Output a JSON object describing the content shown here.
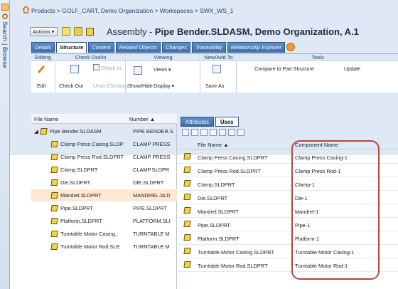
{
  "sidebar": {
    "search": "Search",
    "browse": "Browse"
  },
  "breadcrumb": "Products > GOLF_CART, Demo Organization > Workspaces > SWX_WS_1",
  "actions_label": "Actions ▾",
  "title": {
    "prefix": "Assembly - ",
    "name": "Pipe Bender.SLDASM, Demo Organization, A.1"
  },
  "tabs": [
    "Details",
    "Structure",
    "Content",
    "Related Objects",
    "Changes",
    "Traceability",
    "Relationship Explorer"
  ],
  "ribbon": {
    "editing": {
      "header": "Editing",
      "edit": "Edit"
    },
    "checkout": {
      "header": "Check Out/In",
      "checkin": "Check In",
      "checkout": "Check Out",
      "undo": "Undo Checkout"
    },
    "viewing": {
      "header": "Viewing",
      "views": "Views ▾",
      "showhide": "Show/Hide",
      "display": "Display ▾"
    },
    "newadd": {
      "header": "New/Add To",
      "saveas": "Save As"
    },
    "tools": {
      "header": "Tools",
      "compare": "Compare to Part Structure",
      "update": "Update"
    }
  },
  "tree": {
    "columns": {
      "filename": "File Name",
      "number": "Number ▲"
    },
    "root": {
      "name": "Pipe Bender.SLDASM",
      "number": "PIPE BENDER.S"
    },
    "rows": [
      {
        "name": "Clamp Press Casing.SLDP",
        "number": "CLAMP PRESS"
      },
      {
        "name": "Clamp Press Rod.SLDPRT",
        "number": "CLAMP PRESS"
      },
      {
        "name": "Clamp.SLDPRT",
        "number": "CLAMP.SLDPR"
      },
      {
        "name": "Die.SLDPRT",
        "number": "DIE.SLDPRT"
      },
      {
        "name": "Mandrel.SLDPRT",
        "number": "MANDREL.SLD"
      },
      {
        "name": "Pipe.SLDPRT",
        "number": "PIPE.SLDPRT"
      },
      {
        "name": "Platform.SLDPRT",
        "number": "PLATFORM.SLI"
      },
      {
        "name": "Turntable Motor Casing.:",
        "number": "TURNTABLE M"
      },
      {
        "name": "Turntable Motor Rod.SLE",
        "number": "TURNTABLE M"
      }
    ]
  },
  "uses": {
    "tabs": [
      "Attributes",
      "Uses"
    ],
    "columns": {
      "filename": "File Name ▲",
      "component": "Component Name"
    },
    "rows": [
      {
        "file": "Clamp Press Casing.SLDPRT",
        "component": "Clamp Press Casing-1"
      },
      {
        "file": "Clamp Press Rod.SLDPRT",
        "component": "Clamp Press Rod-1"
      },
      {
        "file": "Clamp.SLDPRT",
        "component": "Clamp-1"
      },
      {
        "file": "Die.SLDPRT",
        "component": "Die-1"
      },
      {
        "file": "Mandrel.SLDPRT",
        "component": "Mandrel-1"
      },
      {
        "file": "Pipe.SLDPRT",
        "component": "Pipe-1"
      },
      {
        "file": "Platform.SLDPRT",
        "component": "Platform-1"
      },
      {
        "file": "Turntable Motor Casing.SLDPRT",
        "component": "Turntable Motor Casing-1"
      },
      {
        "file": "Turntable Motor Rod.SLDPRT",
        "component": "Turntable Motor Rod-1"
      }
    ]
  },
  "colors": {
    "accent": "#3f6da8",
    "highlight": "#b3473f",
    "selected_row": "#fde8d4"
  }
}
